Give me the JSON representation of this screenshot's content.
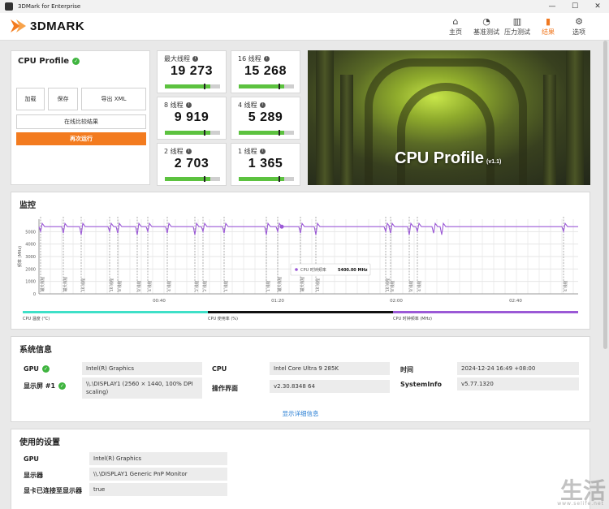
{
  "window": {
    "title": "3DMark for Enterprise",
    "controls": [
      "—",
      "☐",
      "✕"
    ]
  },
  "header": {
    "brand": "3DMARK",
    "nav": [
      {
        "label": "主页",
        "icon": "home-icon",
        "glyph": "⌂",
        "active": false
      },
      {
        "label": "基准测试",
        "icon": "speedometer-icon",
        "glyph": "◔",
        "active": false
      },
      {
        "label": "压力测试",
        "icon": "bar-chart-icon",
        "glyph": "▥",
        "active": false
      },
      {
        "label": "结果",
        "icon": "results-icon",
        "glyph": "▮",
        "active": true
      },
      {
        "label": "选项",
        "icon": "gear-icon",
        "glyph": "⚙",
        "active": false
      }
    ]
  },
  "profile": {
    "title": "CPU Profile",
    "load_label": "加载",
    "save_label": "保存",
    "export_label": "导出 XML",
    "compare_label": "在线比较结果",
    "run_again_label": "再次运行"
  },
  "scores": [
    {
      "label": "最大线程",
      "value": "19 273",
      "fill": 0.82,
      "marker": 0.7
    },
    {
      "label": "16 线程",
      "value": "15 268",
      "fill": 0.82,
      "marker": 0.72
    },
    {
      "label": "8 线程",
      "value": "9 919",
      "fill": 0.82,
      "marker": 0.7
    },
    {
      "label": "4 线程",
      "value": "5 289",
      "fill": 0.82,
      "marker": 0.72
    },
    {
      "label": "2 线程",
      "value": "2 703",
      "fill": 0.82,
      "marker": 0.7
    },
    {
      "label": "1 线程",
      "value": "1 365",
      "fill": 0.82,
      "marker": 0.72
    }
  ],
  "hero": {
    "title": "CPU Profile",
    "version": "(v1.1)"
  },
  "monitor": {
    "title": "监控",
    "y_axis_label": "频率 (MHz)",
    "tooltip_label": "CPU 时钟频率",
    "tooltip_value": "5400.00 MHz",
    "legend": [
      {
        "label": "CPU 温度 (°C)",
        "color": "#3fe0c8"
      },
      {
        "label": "CPU 使用率 (%)",
        "color": "#111111"
      },
      {
        "label": "CPU 时钟频率 (MHz)",
        "color": "#9b59d6"
      }
    ]
  },
  "chart_data": {
    "type": "line",
    "title": "",
    "xlabel": "",
    "ylabel": "频率 (MHz)",
    "y_ticks": [
      0,
      1000,
      2000,
      3000,
      4000,
      5000
    ],
    "x_ticks": [
      "00:40",
      "01:20",
      "02:00",
      "02:40"
    ],
    "ylim": [
      0,
      6000
    ],
    "series": [
      {
        "name": "CPU 时钟频率 (MHz)",
        "color": "#9b59d6",
        "baseline": 5400
      }
    ],
    "markers": [
      "最大线程",
      "最大线程",
      "16 线程",
      "16 线程",
      "8 线程",
      "8 线程",
      "4 线程",
      "4 线程",
      "2 线程",
      "2 线程",
      "1 线程",
      "1 线程"
    ]
  },
  "sysinfo": {
    "title": "系统信息",
    "gpu_label": "GPU",
    "gpu_value": "Intel(R) Graphics",
    "display_label": "显示屏 #1",
    "display_value": "\\\\.\\DISPLAY1 (2560 × 1440, 100% DPI scaling)",
    "cpu_label": "CPU",
    "cpu_value": "Intel Core Ultra 9 285K",
    "os_label": "操作界面",
    "os_value": "v2.30.8348 64",
    "time_label": "时间",
    "time_value": "2024-12-24 16:49 +08:00",
    "si_label": "SystemInfo",
    "si_value": "v5.77.1320",
    "detail_link": "显示详细信息"
  },
  "settings": {
    "title": "使用的设置",
    "rows": [
      {
        "label": "GPU",
        "value": "Intel(R) Graphics"
      },
      {
        "label": "显示器",
        "value": "\\\\.\\DISPLAY1 Generic PnP Monitor"
      },
      {
        "label": "显卡已连接至显示器",
        "value": "true"
      }
    ]
  },
  "watermark": {
    "text": "生活",
    "sub": "www.selife.net"
  }
}
